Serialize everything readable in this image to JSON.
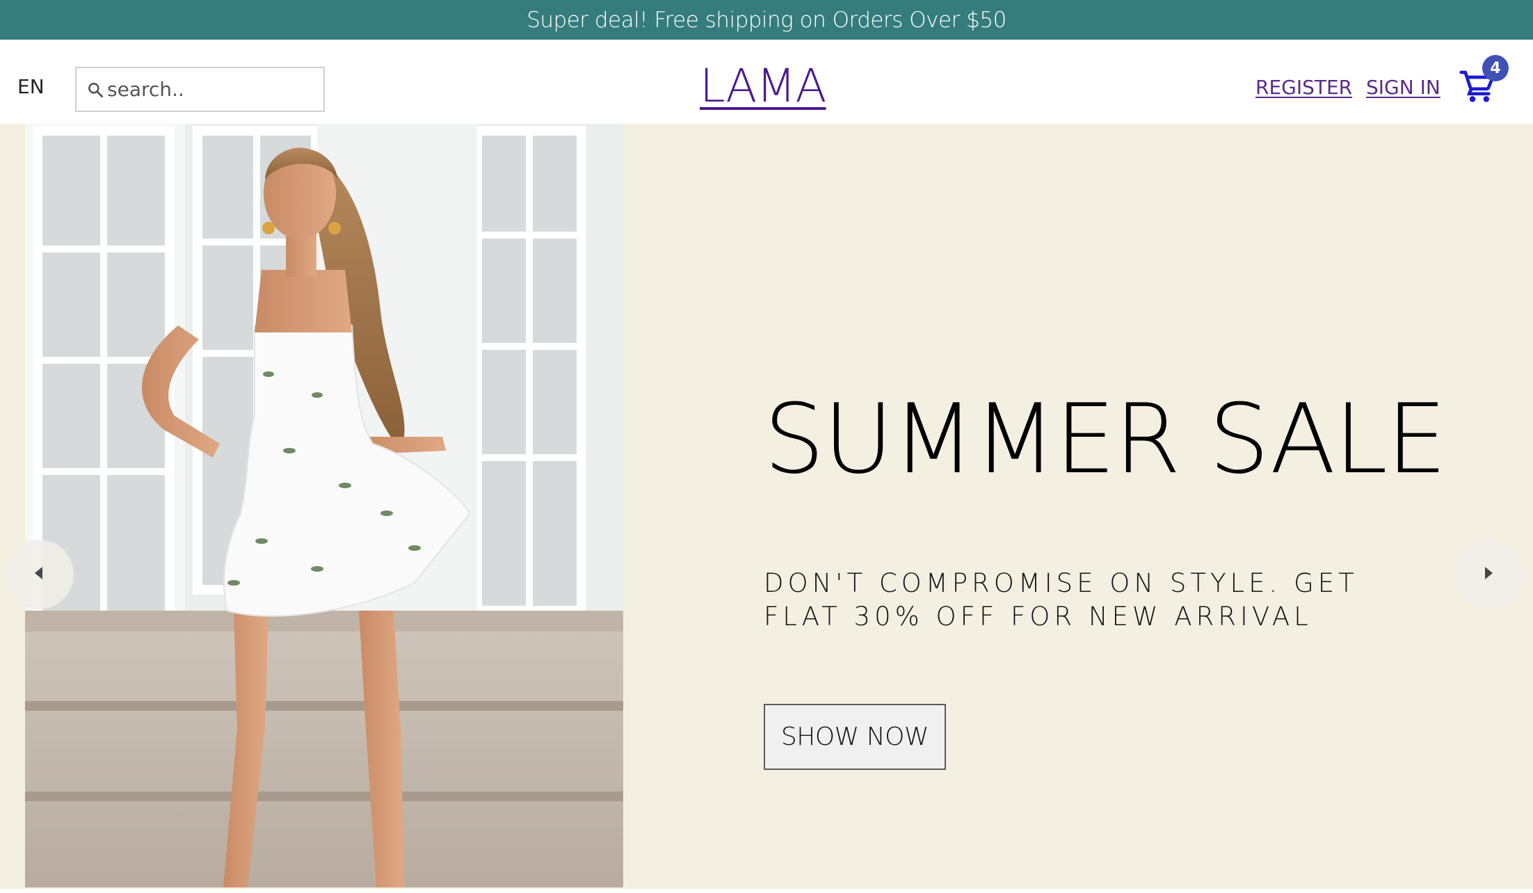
{
  "announcement": {
    "text": "Super deal! Free shipping on Orders Over $50"
  },
  "navbar": {
    "language": "EN",
    "search": {
      "placeholder": "search..",
      "value": ""
    },
    "logo": "LAMA",
    "links": {
      "register": "REGISTER",
      "sign_in": "SIGN IN"
    },
    "cart": {
      "count": "4",
      "icon": "shopping-cart-icon"
    }
  },
  "slider": {
    "title": "SUMMER SALE",
    "description": "DON'T COMPROMISE ON STYLE. GET FLAT 30% OFF FOR NEW ARRIVAL",
    "button_label": "SHOW NOW",
    "left_arrow_icon": "arrow-left-icon",
    "right_arrow_icon": "arrow-right-icon"
  },
  "colors": {
    "announcement_bg": "#357d7c",
    "logo": "#4b1b8f",
    "slide_bg": "#f4f0e1",
    "cart_icon": "#1a1ad6",
    "badge_bg": "#3f51b5"
  }
}
